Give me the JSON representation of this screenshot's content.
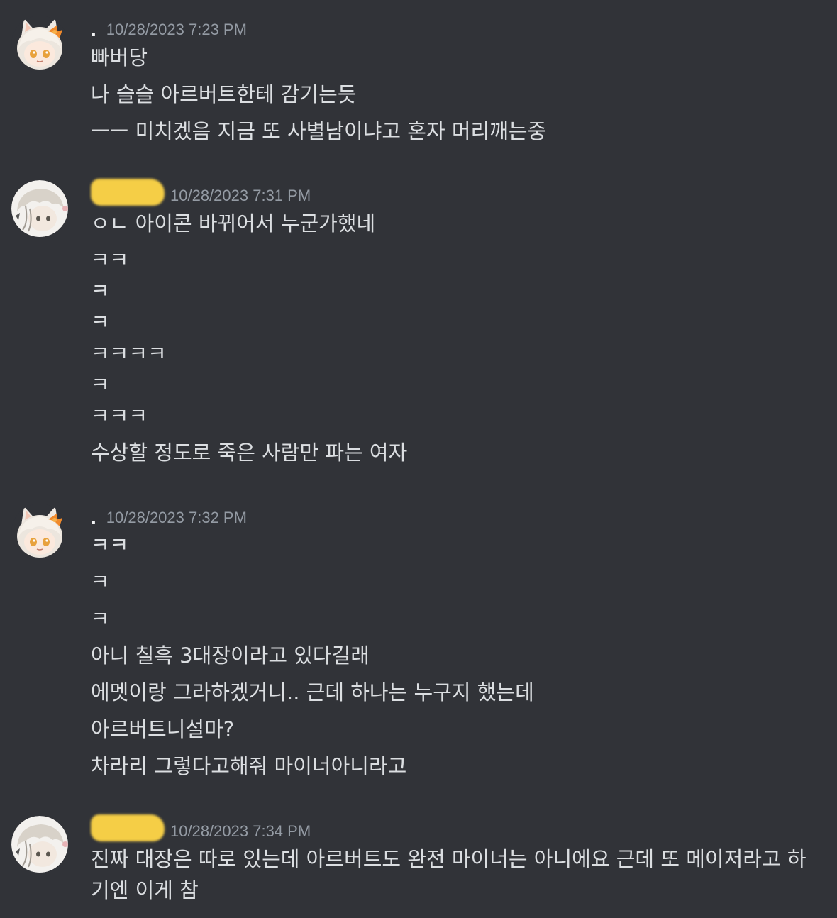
{
  "messages": [
    {
      "author": ".",
      "author_redacted": false,
      "avatar": "fox-girl-avatar-icon",
      "timestamp": "10/28/2023 7:23 PM",
      "lines": [
        "빠버당",
        "나 슬슬 아르버트한테 감기는듯",
        "ㅡㅡ 미치겠음 지금 또 사별남이냐고 혼자 머리깨는중"
      ]
    },
    {
      "author": "",
      "author_redacted": true,
      "avatar": "white-hair-boy-avatar-icon",
      "timestamp": "10/28/2023 7:31 PM",
      "lines": [
        "ㅇㄴ 아이콘 바뀌어서 누군가했네",
        "ㅋㅋ",
        "ㅋ",
        "ㅋ",
        "ㅋㅋㅋㅋ",
        "ㅋ",
        "ㅋㅋㅋ",
        "수상할 정도로 죽은 사람만 파는 여자"
      ]
    },
    {
      "author": ".",
      "author_redacted": false,
      "avatar": "fox-girl-avatar-icon",
      "timestamp": "10/28/2023 7:32 PM",
      "lines": [
        "ㅋㅋ",
        "ㅋ",
        "ㅋ",
        "아니 칠흑 3대장이라고 있다길래",
        "에멧이랑 그라하겠거니.. 근데 하나는 누구지 했는데",
        "아르버트니설마?",
        "차라리 그렇다고해줘 마이너아니라고"
      ]
    },
    {
      "author": "",
      "author_redacted": true,
      "avatar": "white-hair-boy-avatar-icon",
      "timestamp": "10/28/2023 7:34 PM",
      "lines": [
        "진짜 대장은 따로 있는데 아르버트도 완전 마이너는 아니에요 근데 또 메이저라고 하기엔 이게 참"
      ]
    }
  ]
}
